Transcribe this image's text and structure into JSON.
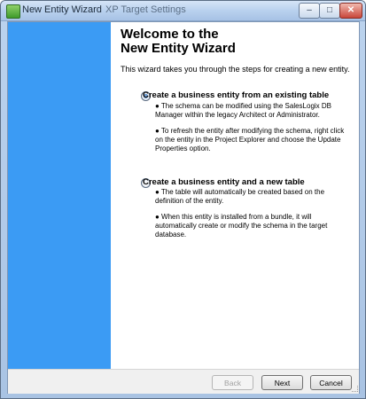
{
  "window": {
    "title": "New Entity Wizard",
    "background_title": "XP Target Settings",
    "minimize_glyph": "–",
    "maximize_glyph": "□",
    "close_glyph": "✕"
  },
  "content": {
    "heading_line1": "Welcome to the",
    "heading_line2": "New Entity Wizard",
    "intro": "This wizard takes you through the steps for creating a new entity."
  },
  "options": [
    {
      "label": "Create a business entity from an existing table",
      "selected": true,
      "notes": [
        "● The schema can be modified using the SalesLogix DB Manager within the legacy Architect or Administrator.",
        "● To refresh the entity after modifying the schema, right click on the entity in the Project Explorer and choose the Update Properties option."
      ]
    },
    {
      "label": "Create a business entity and a new table",
      "selected": false,
      "notes": [
        "● The table will automatically be created based on the definition of the entity.",
        "● When this entity is installed from a bundle, it will automatically create or modify the schema in the target database."
      ]
    }
  ],
  "footer": {
    "back_label": "Back",
    "next_label": "Next",
    "cancel_label": "Cancel"
  },
  "colors": {
    "side_panel": "#3b9bf4",
    "title_bar": "#b9d1ee"
  }
}
